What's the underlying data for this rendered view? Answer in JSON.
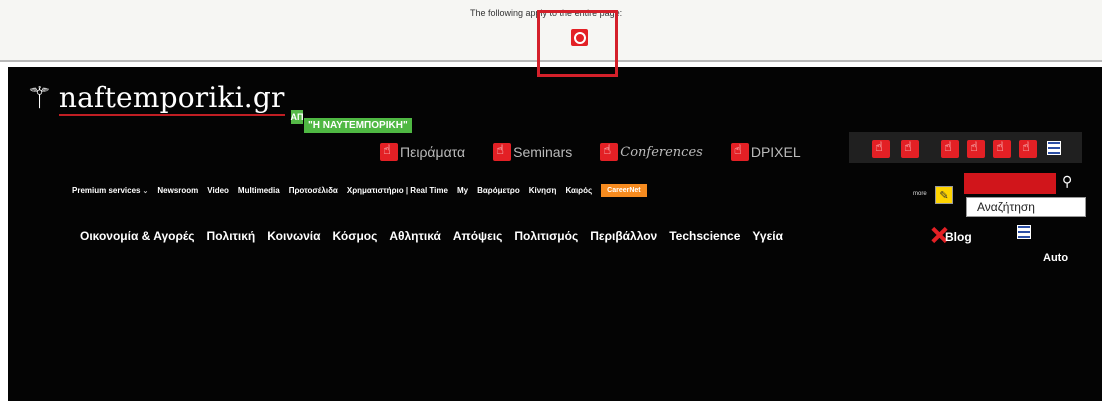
{
  "top_bar": {
    "apply_text": "The following apply to the entire page:",
    "apply_icon": "refresh-icon",
    "highlight_color": "#d4202a"
  },
  "header": {
    "logo": {
      "text": "naftemporiki.gr",
      "icon": "statue-figure-icon"
    },
    "badge": {
      "mini": "ΑΠ",
      "text": "\"Η ΝΑΥΤΕΜΠΟΡΙΚΗ\"",
      "color": "#4fb843"
    },
    "sublinks": [
      "Πειράματα",
      "Seminars",
      "Conferences",
      "DPIXEL"
    ],
    "icon_bar": {
      "hand_icon_count": 6,
      "extra_icon": "list-icon"
    }
  },
  "main_nav": {
    "items": [
      "Premium services",
      "Newsroom",
      "Video",
      "Multimedia",
      "Προτοσέλιδα",
      "Χρηματιστήριο | Real Time",
      "My",
      "Βαρόμετρο",
      "Κίνηση",
      "Καιρός"
    ],
    "careers_label": "CareerNet",
    "careers_color": "#f68b1f",
    "more_label": "more",
    "search": {
      "placeholder": "Αναζήτηση",
      "button_icon": "search-icon",
      "color": "#d1151b"
    }
  },
  "categories": {
    "items": [
      "Οικονομία & Αγορές",
      "Πολιτική",
      "Κοινωνία",
      "Κόσμος",
      "Αθλητικά",
      "Απόψεις",
      "Πολιτισμός",
      "Περιβάλλον",
      "Techscience",
      "Υγεία"
    ],
    "blog_label": "Blog",
    "auto_label": "Auto"
  }
}
